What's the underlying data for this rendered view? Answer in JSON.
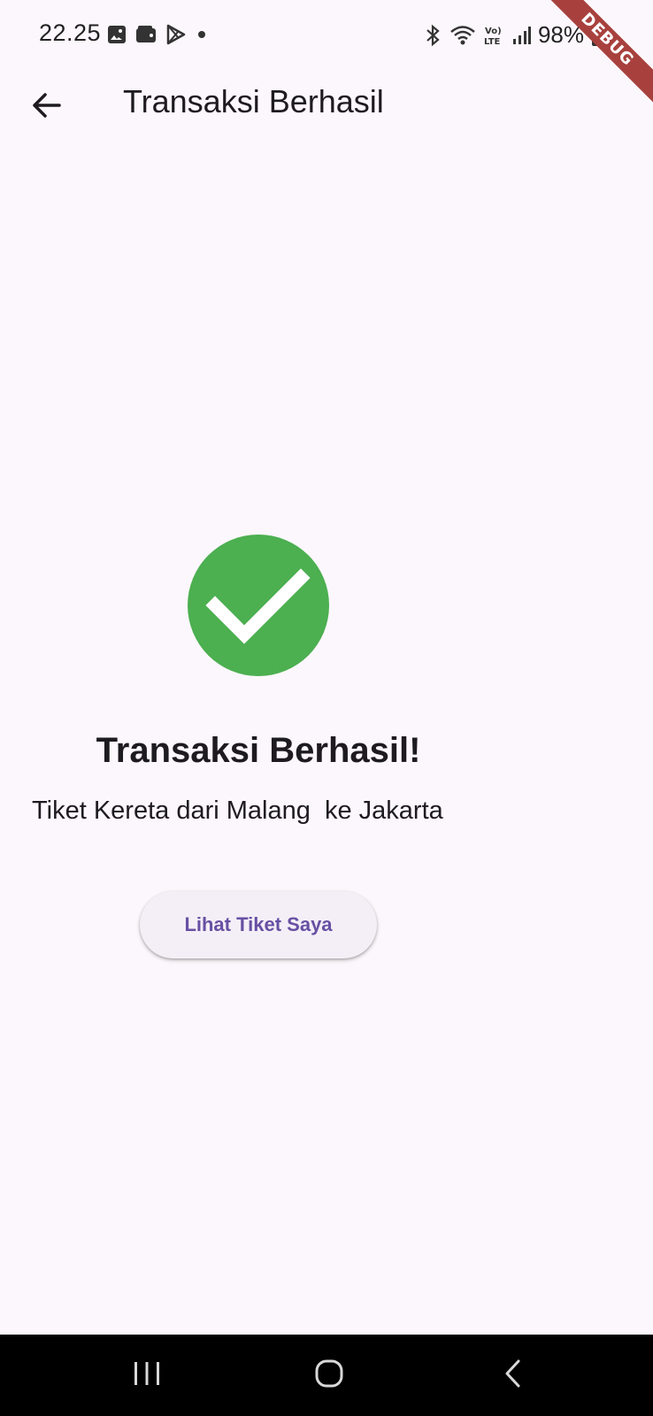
{
  "status_bar": {
    "time": "22.25",
    "battery": "98%",
    "icons_left": [
      "gallery-icon",
      "wallet-icon",
      "play-store-icon",
      "dot-icon"
    ],
    "icons_right": [
      "bluetooth-icon",
      "wifi-icon",
      "volte-icon",
      "signal-icon",
      "battery-icon"
    ]
  },
  "debug_banner": "DEBUG",
  "app_bar": {
    "back_icon": "arrow-back-icon",
    "title": "Transaksi Berhasil"
  },
  "content": {
    "status_icon": "check-circle-icon",
    "status_color": "#4caf50",
    "title": "Transaksi Berhasil!",
    "subtitle": "Tiket Kereta dari Malang  ke Jakarta",
    "button_label": "Lihat Tiket Saya",
    "button_text_color": "#6750a4"
  },
  "nav_bar": {
    "recents_icon": "recents-icon",
    "home_icon": "home-icon",
    "back_icon": "back-icon"
  }
}
